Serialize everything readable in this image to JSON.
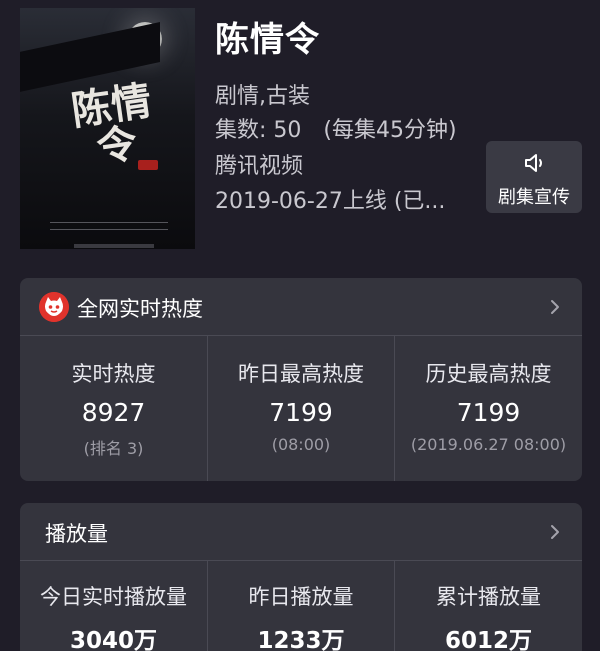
{
  "show": {
    "title": "陈情令",
    "genre": "剧情,古装",
    "episodes": "集数: 50",
    "episode_length": "(每集45分钟)",
    "platform": "腾讯视频",
    "release": "2019-06-27上线 (已..."
  },
  "poster": {
    "title_art": "陈情令"
  },
  "promo_button": {
    "label": "剧集宣传",
    "icon": "speaker-icon"
  },
  "heat_card": {
    "title": "全网实时热度",
    "logo_icon": "cat-logo-icon",
    "logo_color": "#e0332c",
    "stats": [
      {
        "label": "实时热度",
        "value": "8927",
        "sub": "(排名 3)"
      },
      {
        "label": "昨日最高热度",
        "value": "7199",
        "sub": "(08:00)"
      },
      {
        "label": "历史最高热度",
        "value": "7199",
        "sub": "(2019.06.27 08:00)"
      }
    ]
  },
  "play_card": {
    "title": "播放量",
    "stats": [
      {
        "label": "今日实时播放量",
        "value": "3040万"
      },
      {
        "label": "昨日播放量",
        "value": "1233万"
      },
      {
        "label": "累计播放量",
        "value": "6012万"
      }
    ]
  }
}
